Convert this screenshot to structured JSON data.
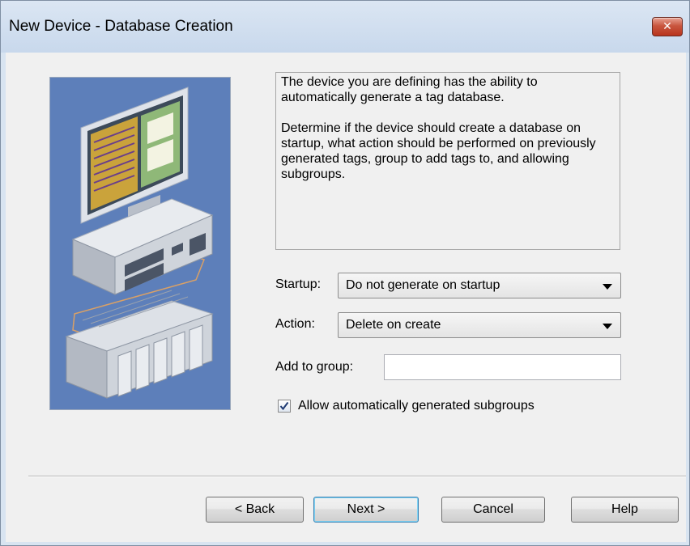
{
  "window": {
    "title": "New Device - Database Creation",
    "close_icon": "close-x-icon"
  },
  "illustration": {
    "icon": "computer-plc-network-illustration"
  },
  "description": {
    "paragraph1": "The device you are defining has the ability to automatically generate a tag database.",
    "paragraph2": "Determine if the device should create a database on startup, what action should be performed on previously generated tags, group to add tags to, and allowing subgroups."
  },
  "form": {
    "startup_label": "Startup:",
    "startup_value": "Do not generate on startup",
    "action_label": "Action:",
    "action_value": "Delete on create",
    "group_label": "Add to group:",
    "group_value": "",
    "subgroups_label": "Allow automatically generated subgroups",
    "subgroups_checked": true
  },
  "buttons": {
    "back": "< Back",
    "next": "Next >",
    "cancel": "Cancel",
    "help": "Help"
  }
}
